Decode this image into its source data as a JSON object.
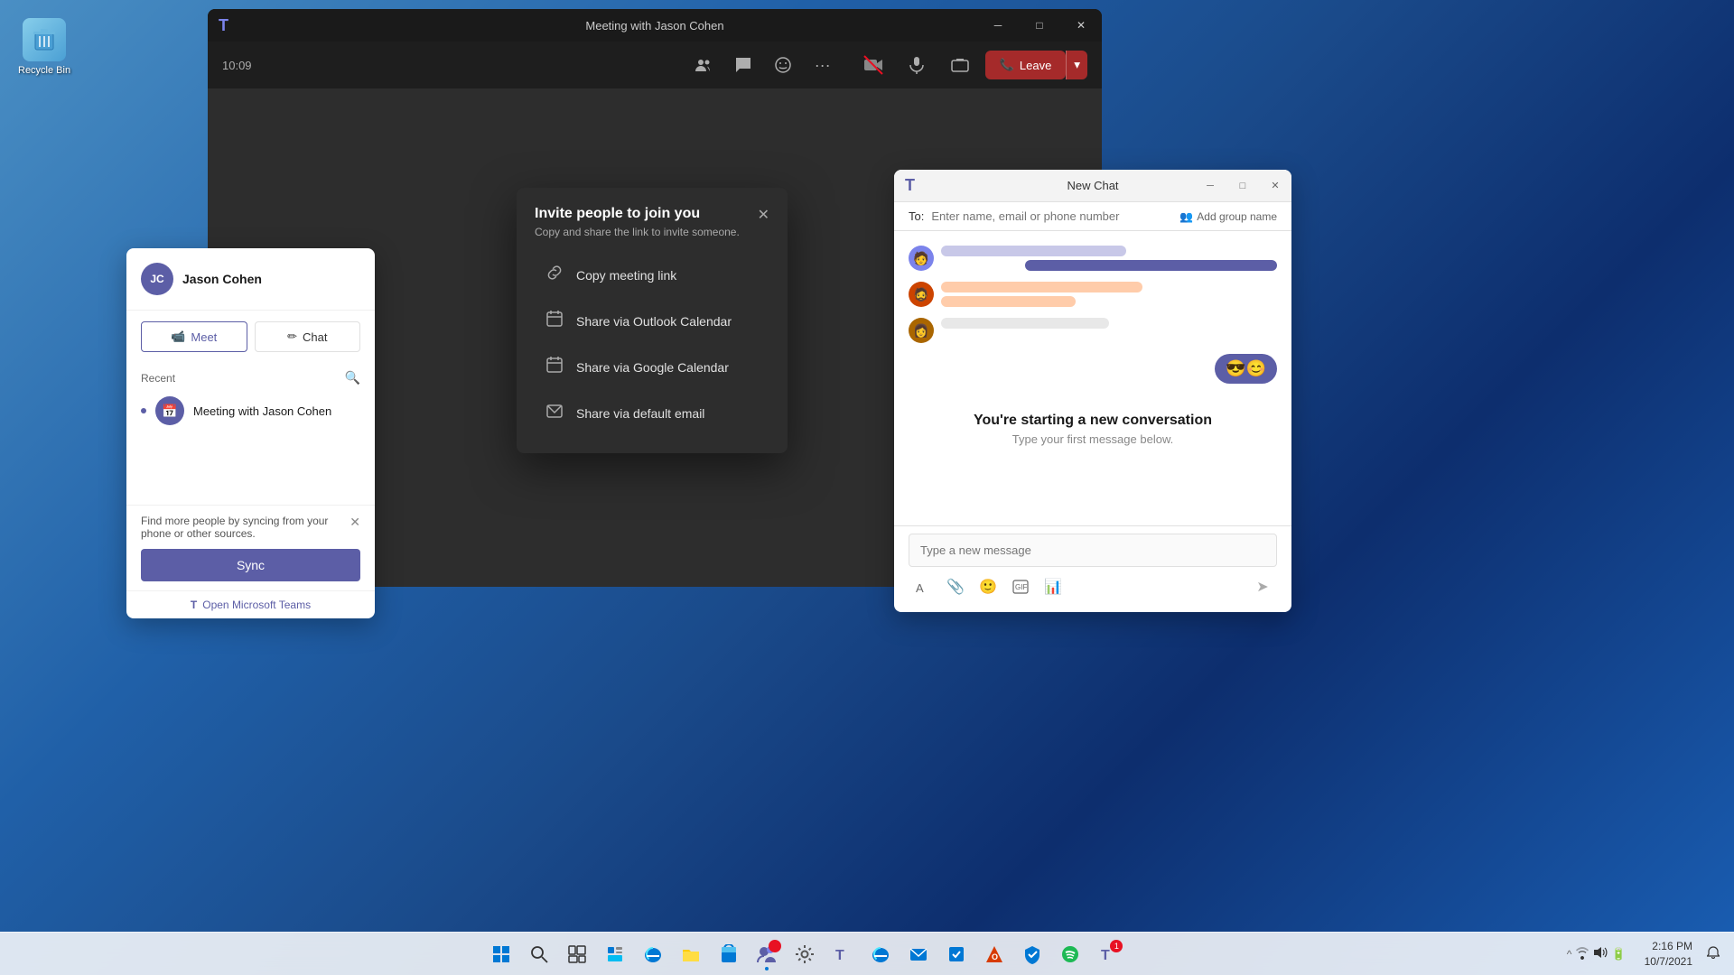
{
  "desktop": {
    "recycle_bin_label": "Recycle Bin"
  },
  "meeting_window": {
    "title": "Meeting with Jason Cohen",
    "time": "10:09",
    "leave_button": "Leave",
    "toolbar_icons": [
      "people",
      "chat",
      "reactions",
      "more"
    ],
    "invite_watermark": "Invite people to join you"
  },
  "contact_card": {
    "initials": "JC",
    "name": "Jason Cohen",
    "meet_button": "Meet",
    "chat_button": "Chat",
    "recent_label": "Recent",
    "recent_meeting": "Meeting with Jason Cohen",
    "sync_notice": "Find more people by syncing from your phone or other sources.",
    "sync_button": "Sync",
    "open_teams_link": "Open Microsoft Teams"
  },
  "invite_modal": {
    "title": "Invite people to join you",
    "subtitle": "Copy and share the link to invite someone.",
    "close_label": "×",
    "options": [
      {
        "label": "Copy meeting link",
        "icon": "🔗"
      },
      {
        "label": "Share via Outlook Calendar",
        "icon": "📅"
      },
      {
        "label": "Share via Google Calendar",
        "icon": "📆"
      },
      {
        "label": "Share via default email",
        "icon": "✉"
      }
    ]
  },
  "new_chat_panel": {
    "title": "New Chat",
    "to_placeholder": "Enter name, email or phone number",
    "add_group_name": "Add group name",
    "message_placeholder": "Type a new message",
    "new_conversation_title": "You're starting a new conversation",
    "new_conversation_sub": "Type your first message below.",
    "emoji_content": "😎😊"
  },
  "taskbar": {
    "icons": [
      {
        "name": "start",
        "symbol": "⊞"
      },
      {
        "name": "search",
        "symbol": "🔍"
      },
      {
        "name": "task-view",
        "symbol": "❑"
      },
      {
        "name": "widgets",
        "symbol": "▣"
      },
      {
        "name": "edge",
        "symbol": "🌐"
      },
      {
        "name": "file-explorer",
        "symbol": "📁"
      },
      {
        "name": "store",
        "symbol": "🏪"
      },
      {
        "name": "teams-chat",
        "symbol": "T",
        "badge": ""
      },
      {
        "name": "settings",
        "symbol": "⚙"
      },
      {
        "name": "teams",
        "symbol": "T"
      },
      {
        "name": "edge2",
        "symbol": "🌐"
      },
      {
        "name": "mail",
        "symbol": "✉"
      },
      {
        "name": "todo",
        "symbol": "☑"
      },
      {
        "name": "office",
        "symbol": "O"
      },
      {
        "name": "security",
        "symbol": "🛡"
      },
      {
        "name": "spotify",
        "symbol": "♫"
      },
      {
        "name": "teams2",
        "symbol": "T",
        "badge": "1"
      }
    ],
    "clock_time": "2:16 PM",
    "clock_date": "10/7/2021"
  }
}
